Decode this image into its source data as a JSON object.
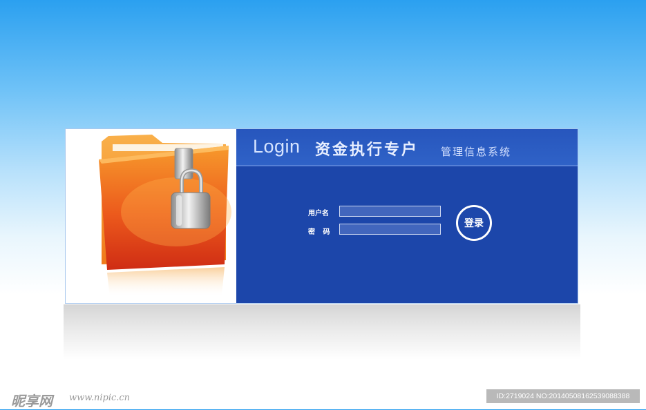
{
  "header": {
    "login_word": "Login",
    "title_main": "资金执行专户",
    "title_sub": "管理信息系统"
  },
  "form": {
    "username_label": "用户名",
    "password_label": "密 码",
    "username_value": "",
    "password_value": "",
    "login_button": "登录"
  },
  "art": {
    "icon": "folder-lock-icon"
  },
  "watermark": {
    "logo": "昵享网",
    "url": "www.nipic.cn",
    "id_text": "ID:2719024 NO:20140508162539088388"
  },
  "colors": {
    "panel_blue": "#1c46aa",
    "header_blue": "#2f62c7",
    "folder_orange": "#f28c1e",
    "folder_red": "#d83a1c"
  }
}
